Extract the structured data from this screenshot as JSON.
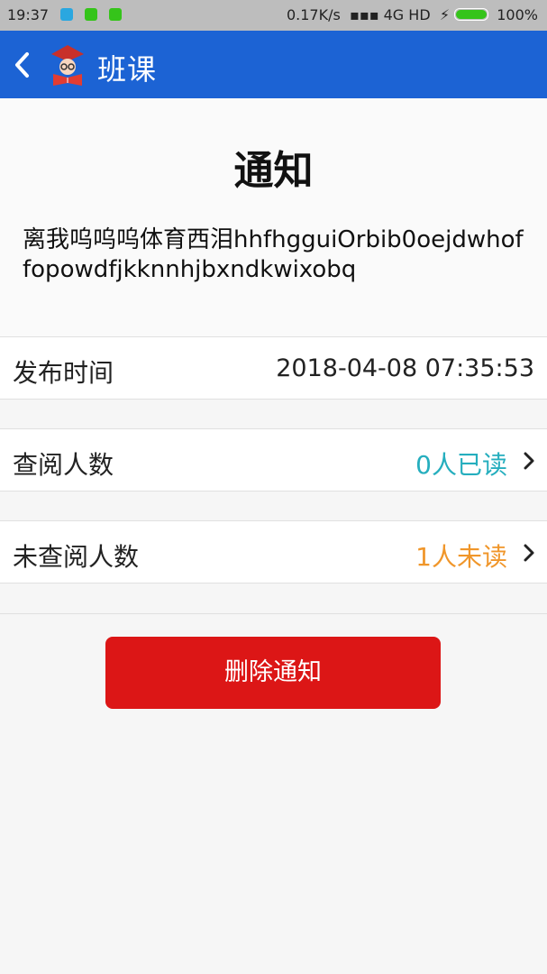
{
  "status_bar": {
    "time": "19:37",
    "network_info": "0.17K/s",
    "signal_label": "4G HD",
    "battery": "100%"
  },
  "app_bar": {
    "title": "班课",
    "back_icon": "chevron-left-icon",
    "logo_icon": "reading-student-icon",
    "color": "#1c63d4"
  },
  "notice": {
    "title": "通知",
    "body": "离我呜呜呜体育西泪hhfhgguiOrbib0oejdwhoffopowdfjkknnhjbxndkwixobq"
  },
  "rows": {
    "publish_time": {
      "label": "发布时间",
      "value": "2018-04-08 07:35:53"
    },
    "read_count": {
      "label": "查阅人数",
      "value": "0人已读",
      "color": "#25aebe"
    },
    "unread_count": {
      "label": "未查阅人数",
      "value": "1人未读",
      "color": "#f0962a"
    }
  },
  "delete_button": {
    "label": "删除通知",
    "color": "#dc1616"
  }
}
